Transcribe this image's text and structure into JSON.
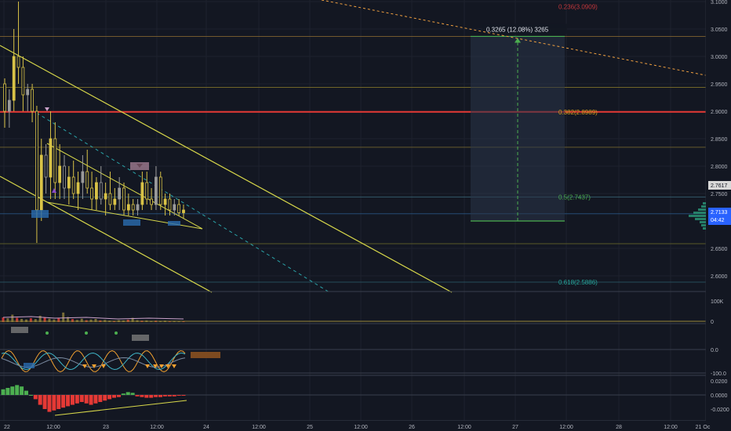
{
  "chart_data": [
    {
      "type": "candlestick",
      "pane": "price",
      "y_axis_ticks": [
        "3.1000",
        "3.0500",
        "3.0000",
        "2.9500",
        "2.9000",
        "2.8500",
        "2.8000",
        "2.7500",
        "2.6500",
        "2.6000"
      ],
      "ylim": [
        2.555,
        3.1
      ],
      "x_axis_ticks": [
        "22",
        "12:00",
        "23",
        "12:00",
        "24",
        "12:00",
        "25",
        "12:00",
        "26",
        "12:00",
        "27",
        "12:00",
        "28",
        "12:00",
        "21 Oc"
      ],
      "price_labels": {
        "ma_price": "2.7617",
        "last_price": "2.7133",
        "countdown": "04:42"
      },
      "fibonacci_levels": [
        {
          "label": "0.236(3.0909)",
          "price": 3.0909,
          "color": "#c2363b"
        },
        {
          "label": "0.382(2.8989)",
          "price": 2.8989,
          "color": "#d9a21e"
        },
        {
          "label": "0.5(2.7437)",
          "price": 2.7437,
          "color": "#4caf50"
        },
        {
          "label": "0.618(2.5886)",
          "price": 2.5886,
          "color": "#26a69a"
        }
      ],
      "horizontal_lines": [
        {
          "price": 3.0365,
          "color": "#8a6a30"
        },
        {
          "price": 2.9435,
          "color": "#8a7a2a"
        },
        {
          "price": 2.899,
          "color": "#e53935"
        },
        {
          "price": 2.8345,
          "color": "#7a6a30"
        },
        {
          "price": 2.7437,
          "color": "#3a6a7a"
        },
        {
          "price": 2.7133,
          "color": "#2a5a8a"
        },
        {
          "price": 2.6585,
          "color": "#6a6a2a"
        },
        {
          "price": 2.5886,
          "color": "#2a5a6a"
        }
      ],
      "measure_tool": {
        "label": "0.3265 (12.08%) 3265",
        "from_price": 2.7,
        "to_price": 3.0365,
        "color": "#4caf50"
      },
      "candles_ohlc": [
        [
          2.95,
          2.96,
          2.87,
          2.9
        ],
        [
          2.9,
          2.94,
          2.87,
          2.92
        ],
        [
          2.92,
          3.05,
          2.9,
          3.0
        ],
        [
          3.0,
          3.1,
          2.95,
          2.98
        ],
        [
          2.98,
          3.0,
          2.9,
          2.93
        ],
        [
          2.93,
          2.95,
          2.9,
          2.94
        ],
        [
          2.94,
          2.95,
          2.88,
          2.9
        ],
        [
          2.9,
          2.91,
          2.66,
          2.72
        ],
        [
          2.72,
          2.85,
          2.7,
          2.82
        ],
        [
          2.82,
          2.84,
          2.75,
          2.78
        ],
        [
          2.78,
          2.9,
          2.74,
          2.85
        ],
        [
          2.85,
          2.88,
          2.74,
          2.77
        ],
        [
          2.77,
          2.84,
          2.74,
          2.8
        ],
        [
          2.8,
          2.82,
          2.74,
          2.76
        ],
        [
          2.76,
          2.8,
          2.73,
          2.78
        ],
        [
          2.78,
          2.81,
          2.74,
          2.75
        ],
        [
          2.75,
          2.79,
          2.72,
          2.77
        ],
        [
          2.77,
          2.82,
          2.74,
          2.79
        ],
        [
          2.79,
          2.83,
          2.75,
          2.76
        ],
        [
          2.76,
          2.79,
          2.72,
          2.74
        ],
        [
          2.74,
          2.78,
          2.72,
          2.77
        ],
        [
          2.77,
          2.8,
          2.73,
          2.74
        ],
        [
          2.74,
          2.77,
          2.71,
          2.75
        ],
        [
          2.75,
          2.79,
          2.72,
          2.73
        ],
        [
          2.73,
          2.76,
          2.72,
          2.74
        ],
        [
          2.74,
          2.78,
          2.72,
          2.76
        ],
        [
          2.76,
          2.77,
          2.71,
          2.72
        ],
        [
          2.72,
          2.75,
          2.71,
          2.73
        ],
        [
          2.73,
          2.74,
          2.71,
          2.72
        ],
        [
          2.72,
          2.74,
          2.71,
          2.73
        ],
        [
          2.73,
          2.79,
          2.72,
          2.77
        ],
        [
          2.77,
          2.79,
          2.73,
          2.74
        ],
        [
          2.74,
          2.76,
          2.72,
          2.73
        ],
        [
          2.73,
          2.8,
          2.72,
          2.78
        ],
        [
          2.78,
          2.79,
          2.72,
          2.73
        ],
        [
          2.73,
          2.75,
          2.71,
          2.74
        ],
        [
          2.74,
          2.75,
          2.71,
          2.72
        ],
        [
          2.72,
          2.74,
          2.71,
          2.73
        ],
        [
          2.73,
          2.74,
          2.71,
          2.715
        ],
        [
          2.715,
          2.73,
          2.705,
          2.72
        ]
      ]
    },
    {
      "type": "bar",
      "pane": "volume",
      "y_axis_ticks": [
        "100K",
        "0"
      ],
      "ylim": [
        0,
        160000
      ],
      "values": [
        22000,
        18000,
        35000,
        20000,
        15000,
        12000,
        18000,
        14000,
        30000,
        22000,
        16000,
        12000,
        20000,
        45000,
        24000,
        14000,
        10000,
        16000,
        9000,
        12000,
        15000,
        8000,
        10000,
        7000,
        6000,
        9000,
        8000,
        11000,
        20000,
        9000,
        7000,
        8000,
        6000,
        7000,
        6000,
        7000,
        5000,
        6000,
        5000,
        4000
      ]
    },
    {
      "type": "line",
      "pane": "oscillator",
      "y_axis_ticks": [
        "0.0",
        "-100.0"
      ],
      "ylim": [
        -150,
        50
      ]
    },
    {
      "type": "bar",
      "pane": "histogram",
      "y_axis_ticks": [
        "0.0200",
        "0.0000",
        "-0.0200"
      ],
      "ylim": [
        -0.032,
        0.03
      ],
      "values": [
        0.008,
        0.01,
        0.012,
        0.014,
        0.012,
        0.006,
        0.0,
        -0.006,
        -0.014,
        -0.02,
        -0.024,
        -0.022,
        -0.02,
        -0.018,
        -0.016,
        -0.014,
        -0.012,
        -0.01,
        -0.012,
        -0.014,
        -0.012,
        -0.01,
        -0.008,
        -0.006,
        -0.004,
        -0.003,
        0.002,
        0.004,
        0.003,
        -0.002,
        -0.003,
        -0.004,
        -0.004,
        -0.003,
        -0.003,
        -0.002,
        -0.002,
        -0.002,
        -0.001,
        -0.001
      ]
    }
  ],
  "colors": {
    "background": "#131722",
    "grid": "#1e222d",
    "axis_text": "#b2b5be",
    "candle": "#d8c247",
    "candle_alt": "#9a9a9a",
    "trendline": "#d8d84a",
    "dashed_trend": "#2aa3a8",
    "fib_trend": "#f0a040",
    "green": "#4caf50",
    "red": "#e53935"
  }
}
